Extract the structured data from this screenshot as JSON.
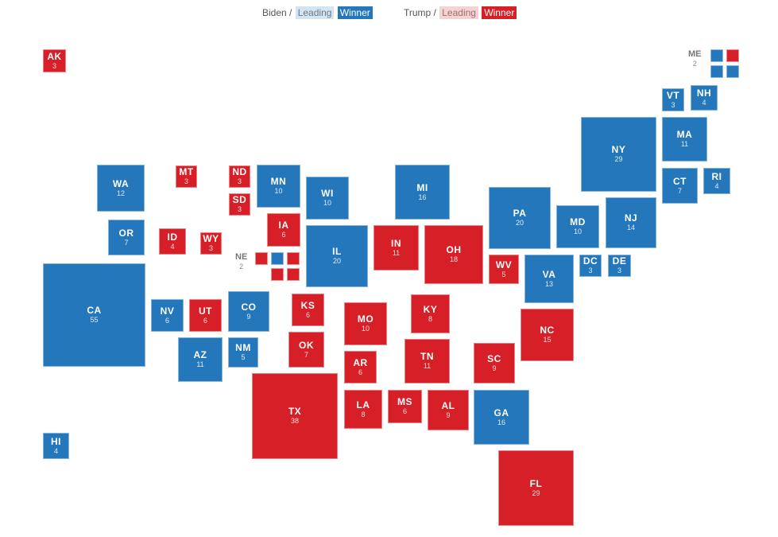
{
  "legend": {
    "biden": {
      "name": "Biden /",
      "leading": "Leading",
      "winner": "Winner"
    },
    "trump": {
      "name": "Trump /",
      "leading": "Leading",
      "winner": "Winner"
    }
  },
  "colors": {
    "biden_winner": "#2577bb",
    "biden_leading": "#d3e4f2",
    "trump_winner": "#d61f26",
    "trump_leading": "#f6d3d3"
  },
  "chart_data": {
    "type": "heatmap",
    "title": "",
    "description": "Electoral tile map: square size proportional to electoral votes, colored by winner",
    "legend": [
      "Biden Leading",
      "Biden Winner",
      "Trump Leading",
      "Trump Winner"
    ],
    "states": [
      {
        "abbr": "AK",
        "ev": 3,
        "winner": "trump"
      },
      {
        "abbr": "ME",
        "ev": 2,
        "winner": "split",
        "districts": [
          "biden",
          "trump",
          "biden",
          "biden"
        ]
      },
      {
        "abbr": "VT",
        "ev": 3,
        "winner": "biden"
      },
      {
        "abbr": "NH",
        "ev": 4,
        "winner": "biden"
      },
      {
        "abbr": "NY",
        "ev": 29,
        "winner": "biden"
      },
      {
        "abbr": "MA",
        "ev": 11,
        "winner": "biden"
      },
      {
        "abbr": "WA",
        "ev": 12,
        "winner": "biden"
      },
      {
        "abbr": "MT",
        "ev": 3,
        "winner": "trump"
      },
      {
        "abbr": "ND",
        "ev": 3,
        "winner": "trump"
      },
      {
        "abbr": "MN",
        "ev": 10,
        "winner": "biden"
      },
      {
        "abbr": "WI",
        "ev": 10,
        "winner": "biden"
      },
      {
        "abbr": "MI",
        "ev": 16,
        "winner": "biden"
      },
      {
        "abbr": "CT",
        "ev": 7,
        "winner": "biden"
      },
      {
        "abbr": "RI",
        "ev": 4,
        "winner": "biden"
      },
      {
        "abbr": "SD",
        "ev": 3,
        "winner": "trump"
      },
      {
        "abbr": "PA",
        "ev": 20,
        "winner": "biden"
      },
      {
        "abbr": "MD",
        "ev": 10,
        "winner": "biden"
      },
      {
        "abbr": "NJ",
        "ev": 14,
        "winner": "biden"
      },
      {
        "abbr": "OR",
        "ev": 7,
        "winner": "biden"
      },
      {
        "abbr": "ID",
        "ev": 4,
        "winner": "trump"
      },
      {
        "abbr": "WY",
        "ev": 3,
        "winner": "trump"
      },
      {
        "abbr": "IA",
        "ev": 6,
        "winner": "trump"
      },
      {
        "abbr": "NE",
        "ev": 2,
        "winner": "split",
        "districts": [
          "trump",
          "biden",
          "trump",
          "trump",
          "trump"
        ]
      },
      {
        "abbr": "IL",
        "ev": 20,
        "winner": "biden"
      },
      {
        "abbr": "IN",
        "ev": 11,
        "winner": "trump"
      },
      {
        "abbr": "OH",
        "ev": 18,
        "winner": "trump"
      },
      {
        "abbr": "WV",
        "ev": 5,
        "winner": "trump"
      },
      {
        "abbr": "VA",
        "ev": 13,
        "winner": "biden"
      },
      {
        "abbr": "DC",
        "ev": 3,
        "winner": "biden"
      },
      {
        "abbr": "DE",
        "ev": 3,
        "winner": "biden"
      },
      {
        "abbr": "CA",
        "ev": 55,
        "winner": "biden"
      },
      {
        "abbr": "NV",
        "ev": 6,
        "winner": "biden"
      },
      {
        "abbr": "UT",
        "ev": 6,
        "winner": "trump"
      },
      {
        "abbr": "CO",
        "ev": 9,
        "winner": "biden"
      },
      {
        "abbr": "KS",
        "ev": 6,
        "winner": "trump"
      },
      {
        "abbr": "MO",
        "ev": 10,
        "winner": "trump"
      },
      {
        "abbr": "KY",
        "ev": 8,
        "winner": "trump"
      },
      {
        "abbr": "NC",
        "ev": 15,
        "winner": "trump"
      },
      {
        "abbr": "AZ",
        "ev": 11,
        "winner": "biden"
      },
      {
        "abbr": "NM",
        "ev": 5,
        "winner": "biden"
      },
      {
        "abbr": "OK",
        "ev": 7,
        "winner": "trump"
      },
      {
        "abbr": "AR",
        "ev": 6,
        "winner": "trump"
      },
      {
        "abbr": "TN",
        "ev": 11,
        "winner": "trump"
      },
      {
        "abbr": "SC",
        "ev": 9,
        "winner": "trump"
      },
      {
        "abbr": "TX",
        "ev": 38,
        "winner": "trump"
      },
      {
        "abbr": "LA",
        "ev": 8,
        "winner": "trump"
      },
      {
        "abbr": "MS",
        "ev": 6,
        "winner": "trump"
      },
      {
        "abbr": "AL",
        "ev": 9,
        "winner": "trump"
      },
      {
        "abbr": "GA",
        "ev": 16,
        "winner": "biden"
      },
      {
        "abbr": "HI",
        "ev": 4,
        "winner": "biden"
      },
      {
        "abbr": "FL",
        "ev": 29,
        "winner": "trump"
      }
    ]
  }
}
